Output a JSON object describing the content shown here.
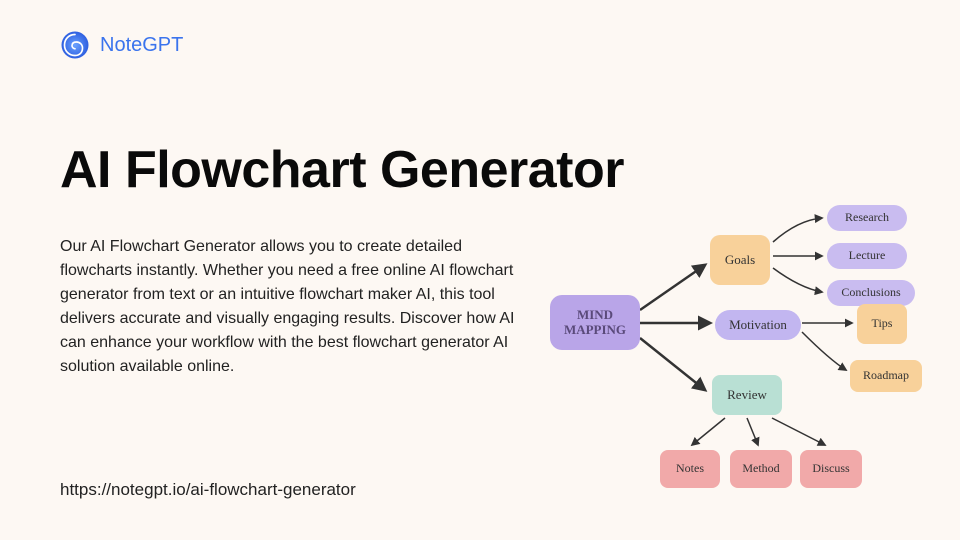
{
  "brand": "NoteGPT",
  "title": "AI Flowchart Generator",
  "description": "Our AI Flowchart Generator allows you to create detailed flowcharts instantly. Whether you need a free online AI flowchart generator from text or an intuitive flowchart maker AI, this tool delivers accurate and visually engaging results. Discover how AI can enhance your workflow with the best flowchart generator AI solution available online.",
  "url": "https://notegpt.io/ai-flowchart-generator",
  "diagram": {
    "root": "MIND MAPPING",
    "goals": "Goals",
    "motivation": "Motivation",
    "review": "Review",
    "research": "Research",
    "lecture": "Lecture",
    "conclusions": "Conclusions",
    "tips": "Tips",
    "roadmap": "Roadmap",
    "notes": "Notes",
    "method": "Method",
    "discuss": "Discuss"
  }
}
